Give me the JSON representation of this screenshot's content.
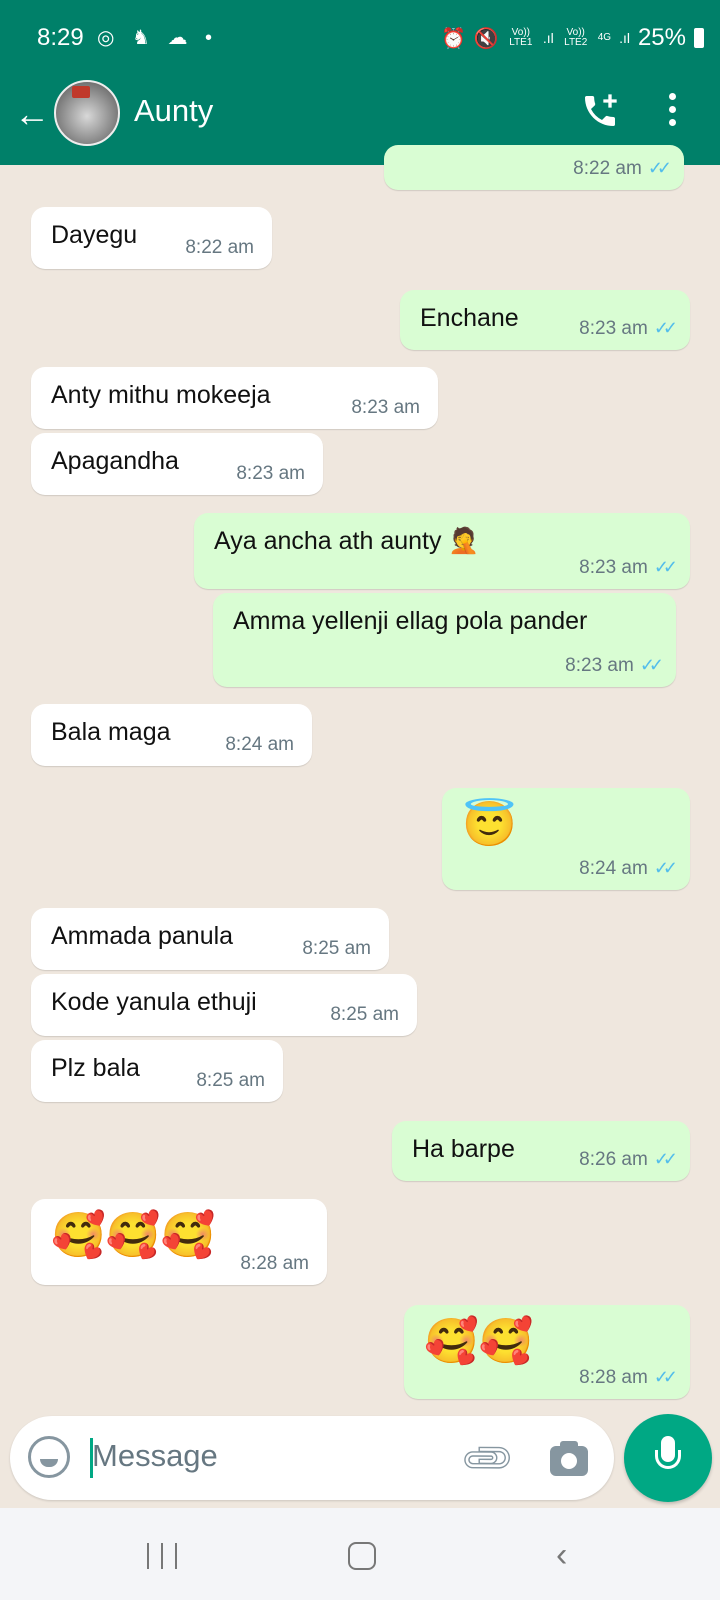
{
  "status_bar": {
    "time": "8:29",
    "notif_icons": [
      "instagram-icon",
      "snapchat-icon",
      "cloud-icon",
      "dot-icon"
    ],
    "sim1": "Vo)) LTE1",
    "sim2": "Vo)) LTE2",
    "network": "4G",
    "battery": "25%"
  },
  "header": {
    "contact_name": "Aunty",
    "back_icon": "arrow-left-icon",
    "call_icon": "add-call-icon",
    "menu_icon": "more-vert-icon"
  },
  "messages": [
    {
      "side": "out",
      "text": "",
      "time": "8:22 am",
      "read": true
    },
    {
      "side": "in",
      "text": "Dayegu",
      "time": "8:22 am"
    },
    {
      "side": "out",
      "text": "Enchane",
      "time": "8:23 am",
      "read": true
    },
    {
      "side": "in",
      "text": "Anty mithu mokeeja",
      "time": "8:23 am"
    },
    {
      "side": "in",
      "text": "Apagandha",
      "time": "8:23 am"
    },
    {
      "side": "out",
      "text": "Aya ancha ath aunty 🤦",
      "time": "8:23 am",
      "read": true
    },
    {
      "side": "out",
      "text": "Amma yellenji ellag pola pander",
      "time": "8:23 am",
      "read": true
    },
    {
      "side": "in",
      "text": "Bala maga",
      "time": "8:24 am"
    },
    {
      "side": "out",
      "text": "😇",
      "time": "8:24 am",
      "read": true
    },
    {
      "side": "in",
      "text": "Ammada panula",
      "time": "8:25 am"
    },
    {
      "side": "in",
      "text": "Kode yanula ethuji",
      "time": "8:25 am"
    },
    {
      "side": "in",
      "text": "Plz  bala",
      "time": "8:25 am"
    },
    {
      "side": "out",
      "text": "Ha barpe",
      "time": "8:26 am",
      "read": true
    },
    {
      "side": "in",
      "text": "🥰🥰🥰",
      "time": "8:28 am"
    },
    {
      "side": "out",
      "text": "🥰🥰",
      "time": "8:28 am",
      "read": true
    }
  ],
  "composer": {
    "placeholder": "Message",
    "emoji_icon": "smiley-icon",
    "attach_icon": "paperclip-icon",
    "camera_icon": "camera-icon",
    "mic_icon": "microphone-icon"
  },
  "colors": {
    "header": "#008069",
    "accent": "#00a884",
    "outgoing_bubble": "#d9fdd3",
    "incoming_bubble": "#ffffff",
    "chat_bg": "#efe7de",
    "read_tick": "#53bdeb"
  }
}
